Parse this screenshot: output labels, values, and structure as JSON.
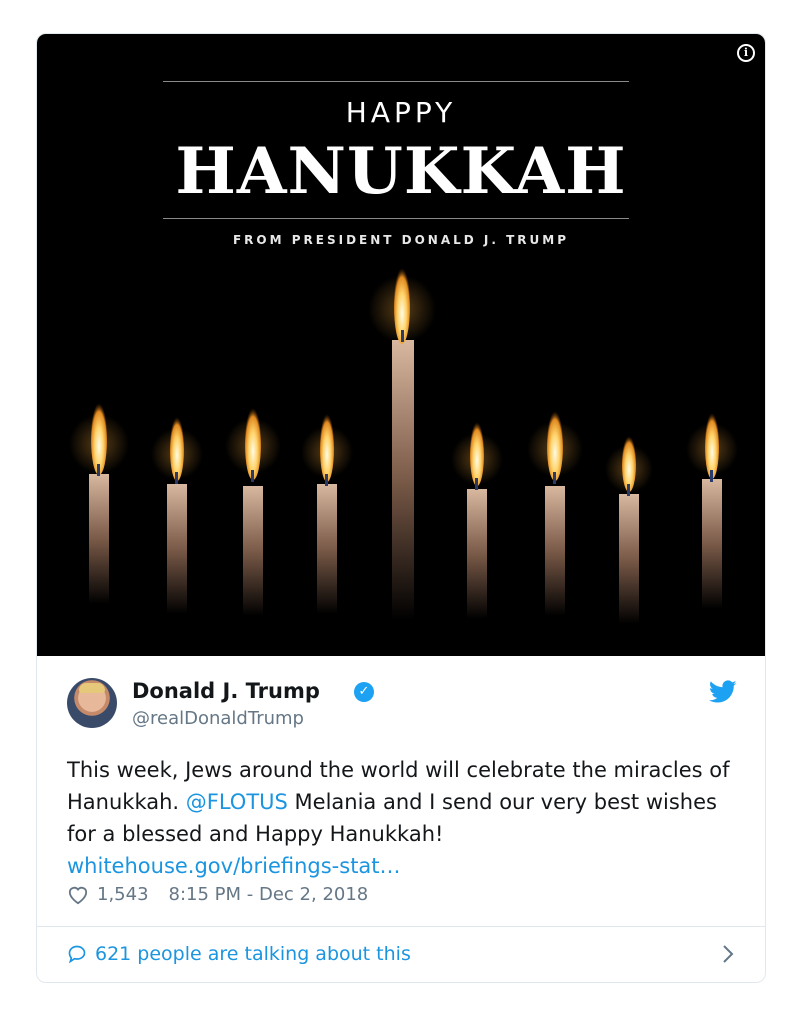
{
  "media": {
    "line1": "HAPPY",
    "line2": "HANUKKAH",
    "line3": "FROM PRESIDENT DONALD J. TRUMP",
    "info_symbol": "i"
  },
  "tweet": {
    "author_name": "Donald J. Trump",
    "handle": "@realDonaldTrump",
    "text_part1": "This week, Jews around the world will celebrate the miracles of Hanukkah. ",
    "mention": "@FLOTUS",
    "text_part2": " Melania and I send our very best wishes for a blessed and Happy Hanukkah!",
    "link": "whitehouse.gov/briefings-stat…",
    "likes": "1,543",
    "timestamp": "8:15 PM - Dec 2, 2018",
    "talking": "621 people are talking about this"
  },
  "colors": {
    "accent": "#1da1f2",
    "link": "#1b95e0",
    "muted": "#657786"
  }
}
